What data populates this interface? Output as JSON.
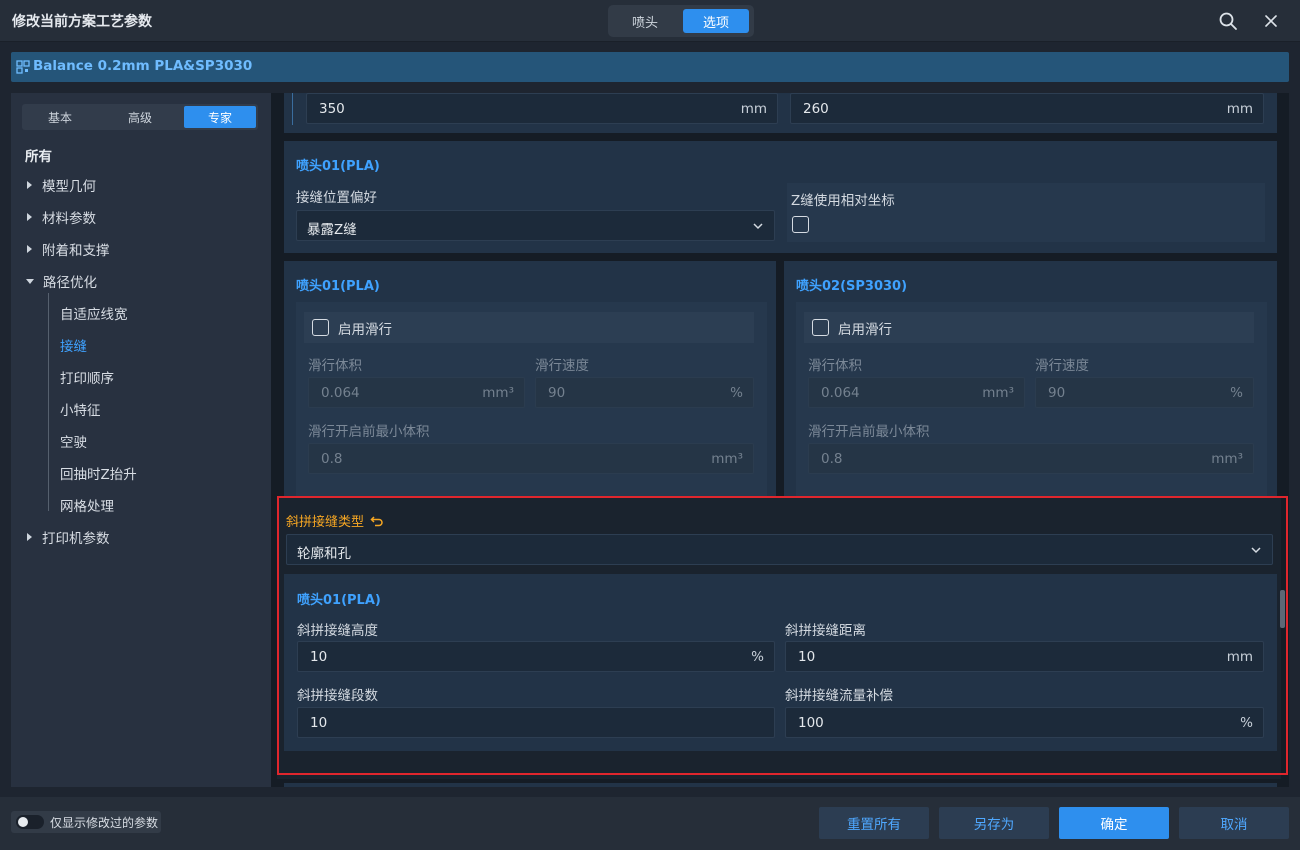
{
  "window": {
    "title": "修改当前方案工艺参数",
    "tabs": [
      "喷头",
      "选项"
    ],
    "active_tab": "选项",
    "search_icon": "search-icon",
    "close_icon": "close-icon"
  },
  "preset": {
    "name": "Balance 0.2mm PLA&SP3030",
    "icon": "qr-grid-icon"
  },
  "sidebar": {
    "levels": [
      "基本",
      "高级",
      "专家"
    ],
    "active_level": "专家",
    "all_label": "所有",
    "categories": [
      {
        "label": "模型几何",
        "expanded": false
      },
      {
        "label": "材料参数",
        "expanded": false
      },
      {
        "label": "附着和支撑",
        "expanded": false
      },
      {
        "label": "路径优化",
        "expanded": true
      },
      {
        "label": "打印机参数",
        "expanded": false
      }
    ],
    "sub_items": [
      "自适应线宽",
      "接缝",
      "打印顺序",
      "小特征",
      "空驶",
      "回抽时Z抬升",
      "网格处理"
    ],
    "active_sub": "接缝"
  },
  "main": {
    "top_fields": [
      {
        "value": "350",
        "unit": "mm"
      },
      {
        "value": "260",
        "unit": "mm"
      }
    ],
    "seam_panel": {
      "title": "喷头01(PLA)",
      "position_label": "接缝位置偏好",
      "position_value": "暴露Z缝",
      "relative_label": "Z缝使用相对坐标",
      "relative_checked": false
    },
    "wipe_panels": [
      {
        "title": "喷头01(PLA)",
        "enable_label": "启用滑行",
        "enabled": false,
        "volume_label": "滑行体积",
        "volume_value": "0.064",
        "volume_unit": "mm³",
        "speed_label": "滑行速度",
        "speed_value": "90",
        "speed_unit": "%",
        "min_label": "滑行开启前最小体积",
        "min_value": "0.8",
        "min_unit": "mm³"
      },
      {
        "title": "喷头02(SP3030)",
        "enable_label": "启用滑行",
        "enabled": false,
        "volume_label": "滑行体积",
        "volume_value": "0.064",
        "volume_unit": "mm³",
        "speed_label": "滑行速度",
        "speed_value": "90",
        "speed_unit": "%",
        "min_label": "滑行开启前最小体积",
        "min_value": "0.8",
        "min_unit": "mm³"
      }
    ],
    "scarf": {
      "type_label": "斜拼接缝类型",
      "type_value": "轮廓和孔",
      "reset_icon": "reset-arrow-icon",
      "label_color": "#f5a623",
      "nozzle_title": "喷头01(PLA)",
      "height_label": "斜拼接缝高度",
      "height_value": "10",
      "height_unit": "%",
      "distance_label": "斜拼接缝距离",
      "distance_value": "10",
      "distance_unit": "mm",
      "steps_label": "斜拼接缝段数",
      "steps_value": "10",
      "flow_label": "斜拼接缝流量补偿",
      "flow_value": "100",
      "flow_unit": "%"
    }
  },
  "footer": {
    "toggle_label": "仅显示修改过的参数",
    "toggle_on": false,
    "buttons": [
      "重置所有",
      "另存为",
      "确定",
      "取消"
    ],
    "primary_button": "确定"
  }
}
